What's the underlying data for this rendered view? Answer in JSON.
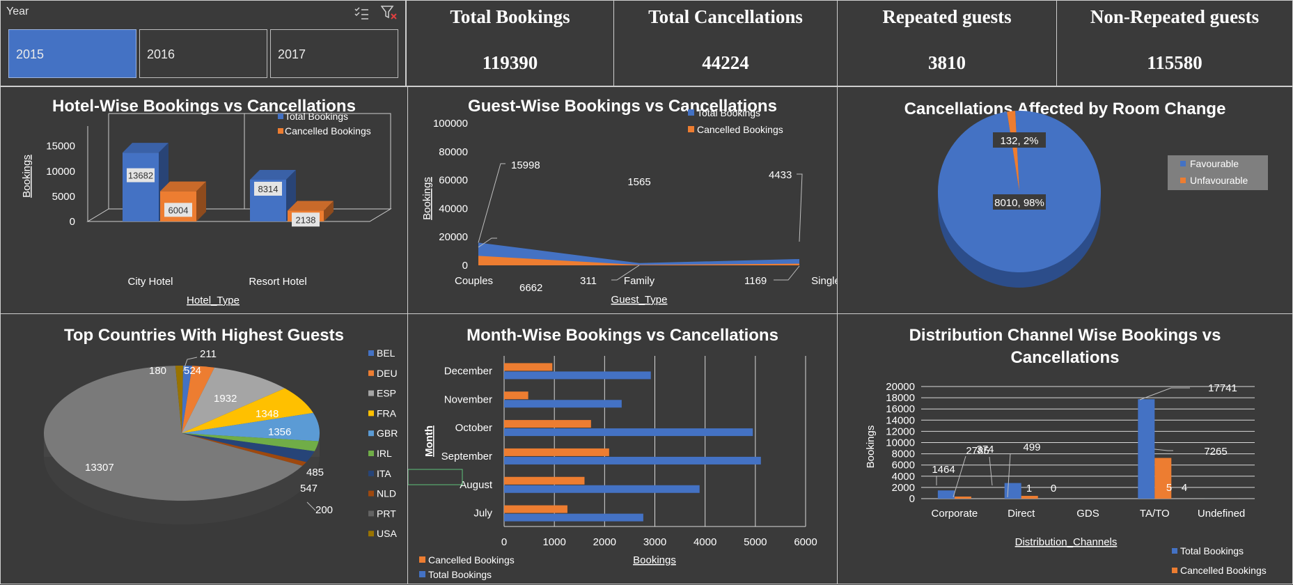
{
  "slicer": {
    "title": "Year",
    "options": [
      "2015",
      "2016",
      "2017"
    ],
    "selected": "2015"
  },
  "kpis": [
    {
      "label": "Total Bookings",
      "value": "119390"
    },
    {
      "label": "Total Cancellations",
      "value": "44224"
    },
    {
      "label": "Repeated guests",
      "value": "3810"
    },
    {
      "label": "Non-Repeated guests",
      "value": "115580"
    }
  ],
  "colors": {
    "blue": "#4472c4",
    "orange": "#ed7d31",
    "gray": "#a5a5a5",
    "yellow": "#ffc000",
    "lightblue": "#5b9bd5",
    "green": "#70ad47",
    "navy": "#264478",
    "brown": "#9e480e",
    "darkgray": "#636363",
    "olive": "#997300",
    "background": "#3a3a3a"
  },
  "chart_data": [
    {
      "id": "hotel",
      "type": "bar",
      "title": "Hotel-Wise Bookings vs Cancellations",
      "xlabel": "Hotel_Type",
      "ylabel": "Bookings",
      "categories": [
        "City Hotel",
        "Resort Hotel"
      ],
      "series": [
        {
          "name": "Total Bookings",
          "values": [
            13682,
            8314
          ]
        },
        {
          "name": "Cancelled Bookings",
          "values": [
            6004,
            2138
          ]
        }
      ],
      "yticks": [
        "0",
        "5000",
        "10000",
        "15000"
      ],
      "ylim": [
        0,
        15000
      ],
      "legend": "top-right"
    },
    {
      "id": "guest",
      "type": "area",
      "title": "Guest-Wise Bookings vs Cancellations",
      "xlabel": "Guest_Type",
      "ylabel": "Bookings",
      "categories": [
        "Couples",
        "Family",
        "Single"
      ],
      "series": [
        {
          "name": "Total Bookings",
          "values": [
            15998,
            1565,
            4433
          ]
        },
        {
          "name": "Cancelled Bookings",
          "values": [
            6662,
            311,
            1169
          ]
        }
      ],
      "yticks": [
        "0",
        "20000",
        "40000",
        "60000",
        "80000",
        "100000"
      ],
      "ylim": [
        0,
        100000
      ],
      "legend": "top-right"
    },
    {
      "id": "room",
      "type": "pie",
      "title": "Cancellations Affected by Room Change",
      "labels": [
        "Favourable",
        "Unfavourable"
      ],
      "values": [
        8010,
        132
      ],
      "data_labels": [
        "8010, 98%",
        "132, 2%"
      ],
      "legend": "right"
    },
    {
      "id": "countries",
      "type": "pie",
      "title": "Top Countries With Highest Guests",
      "labels": [
        "BEL",
        "DEU",
        "ESP",
        "FRA",
        "GBR",
        "IRL",
        "ITA",
        "NLD",
        "PRT",
        "USA"
      ],
      "values": [
        211,
        524,
        1932,
        1348,
        1356,
        485,
        547,
        200,
        13307,
        180
      ],
      "legend": "right"
    },
    {
      "id": "month",
      "type": "bar",
      "orientation": "horizontal",
      "title": "Month-Wise Bookings vs Cancellations",
      "xlabel": "Bookings",
      "ylabel": "Month",
      "categories": [
        "July",
        "August",
        "September",
        "October",
        "November",
        "December"
      ],
      "series": [
        {
          "name": "Total Bookings",
          "values": [
            2770,
            3890,
            5110,
            4950,
            2340,
            2920
          ]
        },
        {
          "name": "Cancelled Bookings",
          "values": [
            1260,
            1600,
            2090,
            1730,
            480,
            960
          ]
        }
      ],
      "xticks": [
        "0",
        "1000",
        "2000",
        "3000",
        "4000",
        "5000",
        "6000"
      ],
      "xlim": [
        0,
        6000
      ],
      "legend": "bottom-left"
    },
    {
      "id": "channel",
      "type": "bar",
      "title": "Distribution Channel Wise Bookings vs Cancellations",
      "title_lines": [
        "Distribution Channel Wise Bookings vs",
        "Cancellations"
      ],
      "xlabel": "Distribution_Channels",
      "ylabel": "Bookings",
      "categories": [
        "Corporate",
        "Direct",
        "GDS",
        "TA/TO",
        "Undefined"
      ],
      "series": [
        {
          "name": "Total Bookings",
          "values": [
            1464,
            2785,
            1,
            17741,
            5
          ]
        },
        {
          "name": "Cancelled Bookings",
          "values": [
            374,
            499,
            0,
            7265,
            4
          ]
        }
      ],
      "yticks": [
        "0",
        "2000",
        "4000",
        "6000",
        "8000",
        "10000",
        "12000",
        "14000",
        "16000",
        "18000",
        "20000"
      ],
      "ylim": [
        0,
        20000
      ],
      "legend": "bottom-right"
    }
  ]
}
